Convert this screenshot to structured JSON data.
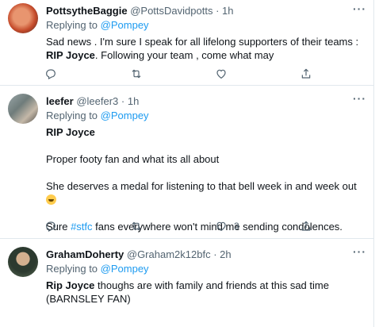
{
  "tweets": [
    {
      "display_name": "PottsytheBaggie",
      "handle": "@PottsDavidpotts",
      "time": "1h",
      "replying_label": "Replying to",
      "replying_to": "@Pompey",
      "text_pre": "Sad news . I'm sure I speak for all lifelong supporters of their teams : ",
      "text_bold": "RIP Joyce",
      "text_post": ". Following your team , come what may",
      "reply_count": "",
      "retweet_count": "",
      "like_count": ""
    },
    {
      "display_name": "leefer",
      "handle": "@leefer3",
      "time": "1h",
      "replying_label": "Replying to",
      "replying_to": "@Pompey",
      "line1": "RIP Joyce",
      "line2": "Proper footy fan and what its all about",
      "line3": "She deserves a medal for listening to that bell week in and week out",
      "line4_pre": "Sure ",
      "line4_hashtag": "#stfc",
      "line4_post": " fans everywhere won't mind me sending condolences.",
      "reply_count": "",
      "retweet_count": "",
      "like_count": "3"
    },
    {
      "display_name": "GrahamDoherty",
      "handle": "@Graham2k12bfc",
      "time": "2h",
      "replying_label": "Replying to",
      "replying_to": "@Pompey",
      "text_bold": "Rip Joyce",
      "text_post": " thoughs are with family and friends at this sad time (BARNSLEY FAN)"
    }
  ],
  "separator": "·",
  "more_glyph": "···",
  "icons": {
    "reply": "reply-icon",
    "retweet": "retweet-icon",
    "like": "like-icon",
    "share": "share-icon",
    "emoji": "grinning-face-emoji"
  },
  "colors": {
    "link": "#1d9bf0",
    "secondary": "#536471",
    "primary": "#0f1419",
    "border": "#e1e8ed"
  }
}
